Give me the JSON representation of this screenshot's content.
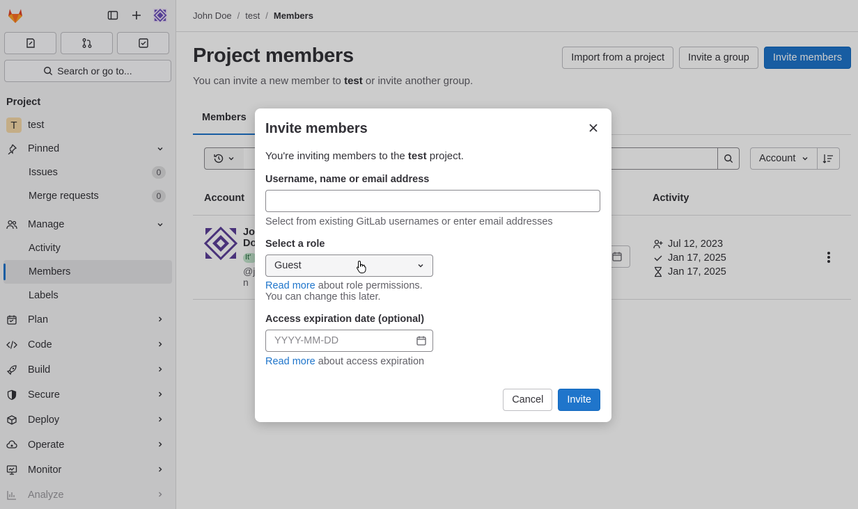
{
  "sidebar": {
    "search_label": "Search or go to...",
    "section_title": "Project",
    "project_name": "test",
    "project_initial": "T",
    "pinned_label": "Pinned",
    "issues_label": "Issues",
    "issues_count": "0",
    "mr_label": "Merge requests",
    "mr_count": "0",
    "manage_label": "Manage",
    "activity_label": "Activity",
    "members_label": "Members",
    "labels_label": "Labels",
    "plan_label": "Plan",
    "code_label": "Code",
    "build_label": "Build",
    "secure_label": "Secure",
    "deploy_label": "Deploy",
    "operate_label": "Operate",
    "monitor_label": "Monitor",
    "analyze_label": "Analyze"
  },
  "breadcrumb": {
    "item1": "John Doe",
    "item2": "test",
    "item3": "Members"
  },
  "page": {
    "title": "Project members",
    "desc_prefix": "You can invite a new member to ",
    "desc_project": "test",
    "desc_suffix": " or invite another group.",
    "import_btn": "Import from a project",
    "invite_group_btn": "Invite a group",
    "invite_members_btn": "Invite members",
    "tab_members": "Members",
    "sort_label": "Account",
    "col_account": "Account",
    "col_activity": "Activity"
  },
  "member_row": {
    "name_line1": "Jo",
    "name_line2": "Do",
    "tag": "It'",
    "user_line1": "@j",
    "user_line2": "n",
    "activity_joined": "Jul 12, 2023",
    "activity_last": "Jan 17, 2025",
    "activity_expires": "Jan 17, 2025"
  },
  "modal": {
    "title": "Invite members",
    "intro_prefix": "You're inviting members to the ",
    "intro_project": "test",
    "intro_suffix": " project.",
    "username_label": "Username, name or email address",
    "username_value": "",
    "username_help": "Select from existing GitLab usernames or enter email addresses",
    "role_label": "Select a role",
    "role_value": "Guest",
    "role_link": "Read more",
    "role_help_suffix": " about role permissions.",
    "role_help_line2": "You can change this later.",
    "expiry_label": "Access expiration date (optional)",
    "expiry_placeholder": "YYYY-MM-DD",
    "expiry_link": "Read more",
    "expiry_help_suffix": " about access expiration",
    "cancel_btn": "Cancel",
    "invite_btn": "Invite"
  },
  "colors": {
    "accent": "#1f75cb",
    "brand_orange": "#e24329",
    "sidebar_bg": "#f4f4f5"
  },
  "icons": [
    "tanuki-logo-icon",
    "sidebar-toggle-icon",
    "plus-icon",
    "user-avatar-icon",
    "issues-icon",
    "merge-request-icon",
    "todo-icon",
    "search-icon",
    "pin-icon",
    "users-icon",
    "chevron-down-icon",
    "chevron-right-icon",
    "calendar-icon",
    "kebab-icon",
    "close-icon",
    "history-icon",
    "sort-icon"
  ]
}
